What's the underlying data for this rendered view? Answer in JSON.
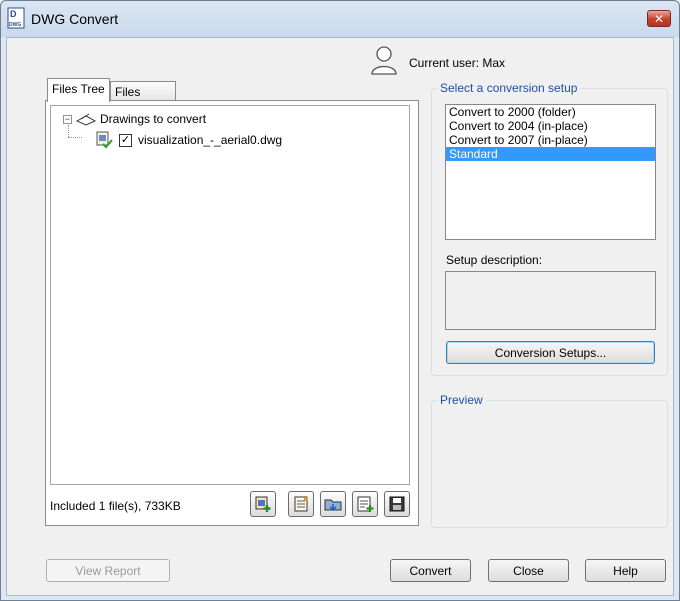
{
  "window": {
    "title": "DWG Convert",
    "close_glyph": "✕",
    "accent": "#c4412f"
  },
  "user": {
    "label": "Current user: Max"
  },
  "tabs": [
    {
      "label": "Files Tree"
    },
    {
      "label": "Files Table"
    }
  ],
  "tree": {
    "root_label": "Drawings to convert",
    "expander_glyph": "−",
    "files": [
      {
        "name": "visualization_-_aerial0.dwg",
        "checked": "✓"
      }
    ]
  },
  "status": {
    "included": "Included 1 file(s), 733KB"
  },
  "toolbar_icons": [
    "add-file-icon",
    "file-list-icon",
    "open-folder-icon",
    "list-add-icon",
    "save-icon"
  ],
  "conversion": {
    "group_title": "Select a conversion setup",
    "setups": [
      {
        "label": "Convert to 2000 (folder)"
      },
      {
        "label": "Convert to 2004 (in-place)"
      },
      {
        "label": "Convert to 2007 (in-place)"
      },
      {
        "label": "Standard"
      }
    ],
    "selected_index": 3,
    "description_label": "Setup description:",
    "setups_button": "Conversion Setups..."
  },
  "preview": {
    "title": "Preview"
  },
  "footer": {
    "view_report": "View Report",
    "convert": "Convert",
    "close": "Close",
    "help": "Help"
  }
}
